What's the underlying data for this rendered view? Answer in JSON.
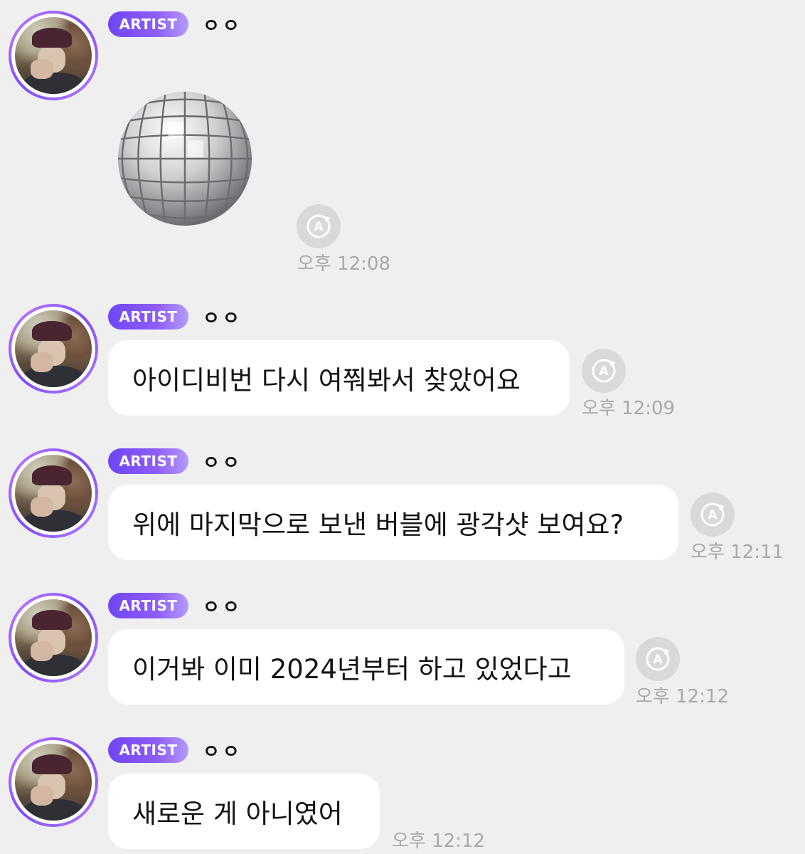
{
  "messages": [
    {
      "badge": "ARTIST",
      "sender": "ㅇㅇ",
      "type": "sticker",
      "sticker": "disco-ball",
      "time": "오후 12:08",
      "translatable": true
    },
    {
      "badge": "ARTIST",
      "sender": "ㅇㅇ",
      "type": "text",
      "text": "아이디비번 다시 여쭤봐서 찾았어요",
      "time": "오후 12:09",
      "translatable": true
    },
    {
      "badge": "ARTIST",
      "sender": "ㅇㅇ",
      "type": "text",
      "text": "위에 마지막으로 보낸 버블에 광각샷 보여요?",
      "time": "오후 12:11",
      "translatable": true
    },
    {
      "badge": "ARTIST",
      "sender": "ㅇㅇ",
      "type": "text",
      "text": "이거봐 이미 2024년부터 하고 있었다고",
      "time": "오후 12:12",
      "translatable": true
    },
    {
      "badge": "ARTIST",
      "sender": "ㅇㅇ",
      "type": "text",
      "text": "새로운 게 아니였어",
      "time": "오후 12:12",
      "translatable": false
    }
  ],
  "colors": {
    "background": "#efefef",
    "badge_start": "#6f45f7",
    "badge_end": "#b39bfb",
    "avatar_ring": "#8d5cf9",
    "time_text": "#a9a9a9",
    "bubble": "#ffffff"
  },
  "icons": {
    "translate": "translate-icon",
    "sticker": "disco-ball-sticker"
  }
}
